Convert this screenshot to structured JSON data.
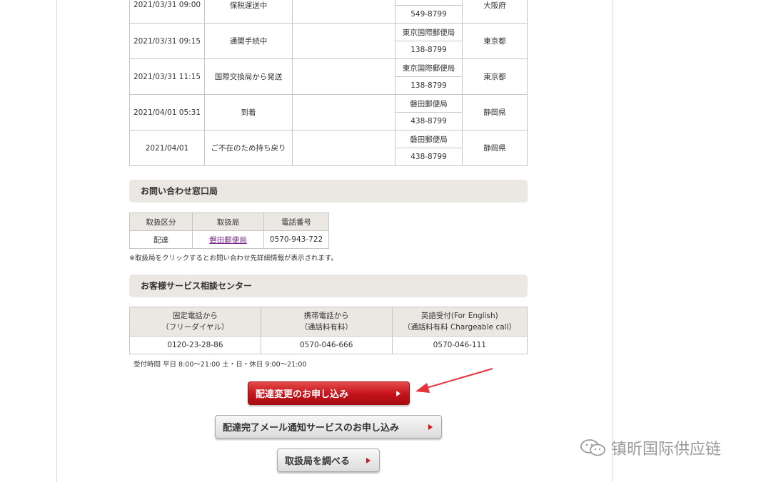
{
  "tracking": {
    "rows": [
      {
        "datetime": "2021/03/31 09:00",
        "status": "保税運送中",
        "detail": "",
        "office": "",
        "postal": "549-8799",
        "prefecture": "大阪府"
      },
      {
        "datetime": "2021/03/31 09:15",
        "status": "通関手続中",
        "detail": "",
        "office": "東京国際郵便局",
        "postal": "138-8799",
        "prefecture": "東京都"
      },
      {
        "datetime": "2021/03/31 11:15",
        "status": "国際交換局から発送",
        "detail": "",
        "office": "東京国際郵便局",
        "postal": "138-8799",
        "prefecture": "東京都"
      },
      {
        "datetime": "2021/04/01 05:31",
        "status": "到着",
        "detail": "",
        "office": "磐田郵便局",
        "postal": "438-8799",
        "prefecture": "静岡県"
      },
      {
        "datetime": "2021/04/01",
        "status": "ご不在のため持ち戻り",
        "detail": "",
        "office": "磐田郵便局",
        "postal": "438-8799",
        "prefecture": "静岡県"
      }
    ]
  },
  "contact": {
    "heading": "お問い合わせ窓口局",
    "headers": [
      "取扱区分",
      "取扱局",
      "電話番号"
    ],
    "row": {
      "type": "配達",
      "office": "磐田郵便局",
      "phone": "0570-943-722"
    },
    "note": "※取扱局をクリックするとお問い合わせ先詳細情報が表示されます。"
  },
  "service_center": {
    "heading": "お客様サービス相談センター",
    "headers": [
      {
        "line1": "固定電話から",
        "line2": "（フリーダイヤル）"
      },
      {
        "line1": "携帯電話から",
        "line2": "（通話料有料）"
      },
      {
        "line1": "英語受付(For English)",
        "line2": "（通話料有料 Chargeable call）"
      }
    ],
    "numbers": [
      "0120-23-28-86",
      "0570-046-666",
      "0570-046-111"
    ],
    "hours": "受付時間 平日 8:00～21:00 土・日・休日 9:00～21:00"
  },
  "buttons": {
    "redelivery": "配達変更のお申し込み",
    "notify": "配達完了メール通知サービスのお申し込み",
    "lookup": "取扱局を調べる"
  },
  "watermark": "镇昕国际供应链",
  "colors": {
    "accent_red": "#c4121a",
    "section_bg": "#ebe7e3",
    "link": "#7b2a8c",
    "arrow": "#e8323c"
  }
}
